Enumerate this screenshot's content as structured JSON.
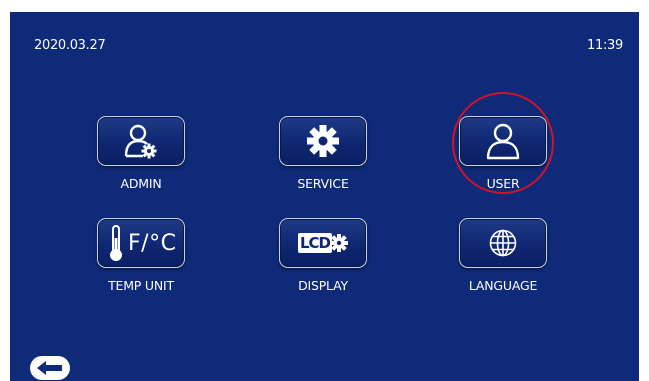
{
  "status_bar": {
    "date": "2020.03.27",
    "time": "11:39"
  },
  "menu": {
    "admin": {
      "label": "ADMIN",
      "icon": "admin-user-gear-icon"
    },
    "service": {
      "label": "SERVICE",
      "icon": "gear-icon"
    },
    "user": {
      "label": "USER",
      "icon": "user-icon"
    },
    "temp_unit": {
      "label": "TEMP UNIT",
      "icon": "thermometer-icon",
      "icon_text": "F/°C"
    },
    "display": {
      "label": "DISPLAY",
      "icon": "lcd-gear-icon",
      "icon_text": "LCD"
    },
    "language": {
      "label": "LANGUAGE",
      "icon": "globe-icon"
    }
  },
  "highlight": {
    "target": "user",
    "color": "#d0122a"
  },
  "navigation": {
    "back_icon": "back-arrow-icon"
  },
  "colors": {
    "background": "#0e2a78",
    "button_border": "#c9cfe4",
    "text": "#ffffff"
  }
}
